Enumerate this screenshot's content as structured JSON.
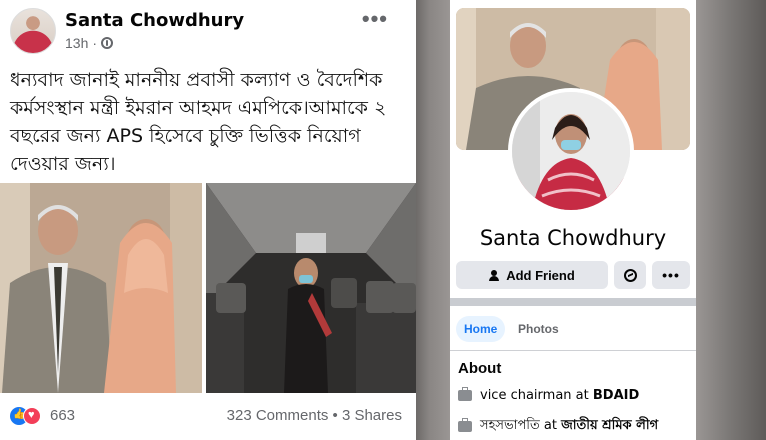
{
  "post": {
    "author": "Santa Chowdhury",
    "time": "13h",
    "more": "•••",
    "text": "ধন্যবাদ জানাই মাননীয় প্রবাসী কল্যাণ ও বৈদেশিক কর্মসংস্থান মন্ত্রী ইমরান আহমদ এমপিকে।আমাকে ২ বছরের জন্য  APS হিসেবে চুক্তি ভিত্তিক নিয়োগ দেওয়ার জন্য।",
    "reaction_count": "663",
    "comments_shares": "323 Comments • 3 Shares"
  },
  "profile": {
    "name": "Santa Chowdhury",
    "add_friend": "Add Friend",
    "more": "•••",
    "tabs": [
      {
        "label": "Home"
      },
      {
        "label": "Photos"
      }
    ],
    "about_title": "About",
    "about": [
      {
        "text": "vice chairman at ",
        "org": "BDAID"
      },
      {
        "text": "সহসভাপতি at ",
        "org": "জাতীয় শ্রমিক লীগ"
      }
    ]
  },
  "colors": {
    "accent": "#1877f2",
    "muted": "#65676b",
    "button_bg": "#e4e6eb"
  }
}
